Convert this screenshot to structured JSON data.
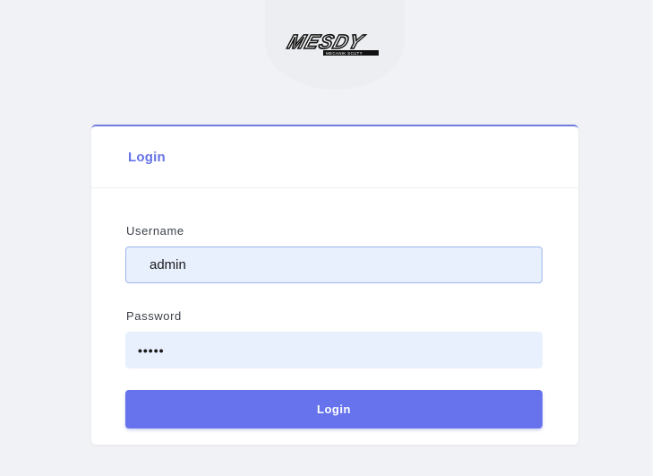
{
  "brand": {
    "logo_text": "MESDY",
    "logo_subtext": "MECANIK SCUTY"
  },
  "login": {
    "title": "Login",
    "username_label": "Username",
    "username_value": "admin",
    "password_label": "Password",
    "password_value": "•••••",
    "submit_label": "Login"
  },
  "colors": {
    "accent": "#6673ec",
    "input_bg": "#e8f0fe",
    "page_bg": "#f1f2f5"
  },
  "icons": [
    "brand-logo"
  ]
}
